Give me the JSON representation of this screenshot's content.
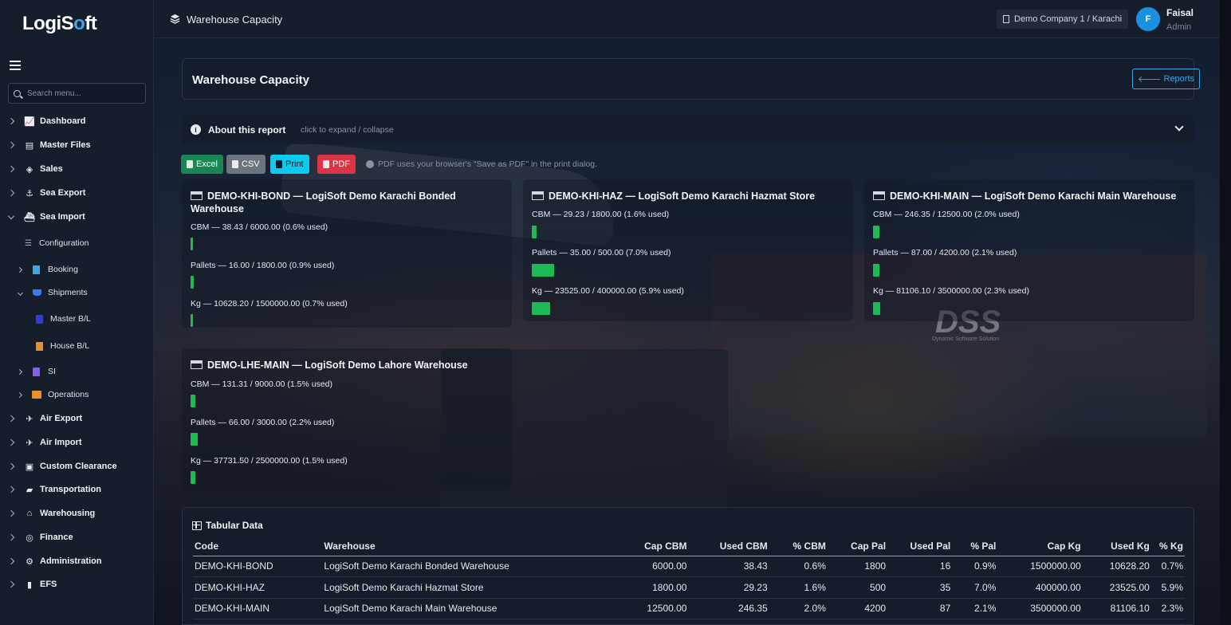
{
  "app": {
    "logo_prefix": "LogiS",
    "logo_o": "o",
    "logo_suffix": "ft",
    "accent": "#3aa8e8",
    "bar_color": "#1db954"
  },
  "sidebar": {
    "search_placeholder": "Search menu...",
    "items": [
      {
        "label": "Dashboard",
        "icon": "chart-line-icon"
      },
      {
        "label": "Master Files",
        "icon": "database-icon"
      },
      {
        "label": "Sales",
        "icon": "handshake-icon"
      },
      {
        "label": "Sea Export",
        "icon": "anchor-icon"
      },
      {
        "label": "Sea Import",
        "icon": "ship-icon"
      },
      {
        "label": "Air Export",
        "icon": "plane-departure-icon"
      },
      {
        "label": "Air Import",
        "icon": "plane-arrival-icon"
      },
      {
        "label": "Custom Clearance",
        "icon": "file-clearance-icon"
      },
      {
        "label": "Transportation",
        "icon": "truck-icon"
      },
      {
        "label": "Warehousing",
        "icon": "warehouse-icon"
      },
      {
        "label": "Finance",
        "icon": "coins-icon"
      },
      {
        "label": "Administration",
        "icon": "gear-icon"
      },
      {
        "label": "EFS",
        "icon": "folder-icon"
      }
    ],
    "sea_import_children": {
      "configuration": "Configuration",
      "booking": "Booking",
      "shipments": "Shipments",
      "master_bl": "Master B/L",
      "house_bl": "House B/L",
      "si": "SI",
      "operations": "Operations"
    }
  },
  "topbar": {
    "title": "Warehouse Capacity",
    "company": "Demo Company 1 / Karachi",
    "avatar_letter": "F",
    "user_name": "Faisal",
    "user_role": "Admin"
  },
  "page": {
    "title": "Warehouse Capacity",
    "reports_button": "Reports",
    "about_title": "About this report",
    "about_hint": "click to expand / collapse",
    "buttons": {
      "excel": "Excel",
      "csv": "CSV",
      "print": "Print",
      "pdf": "PDF"
    },
    "pdf_note": "PDF uses your browser's \"Save as PDF\" in the print dialog."
  },
  "warehouses": [
    {
      "title": "DEMO-KHI-BOND — LogiSoft Demo Karachi Bonded Warehouse",
      "cbm": {
        "label": "CBM — 38.43 / 6000.00 (0.6% used)",
        "pct": 0.6
      },
      "pallets": {
        "label": "Pallets — 16.00 / 1800.00 (0.9% used)",
        "pct": 0.9
      },
      "kg": {
        "label": "Kg — 10628.20 / 1500000.00 (0.7% used)",
        "pct": 0.7
      }
    },
    {
      "title": "DEMO-KHI-HAZ — LogiSoft Demo Karachi Hazmat Store",
      "cbm": {
        "label": "CBM — 29.23 / 1800.00 (1.6% used)",
        "pct": 1.6
      },
      "pallets": {
        "label": "Pallets — 35.00 / 500.00 (7.0% used)",
        "pct": 7.0
      },
      "kg": {
        "label": "Kg — 23525.00 / 400000.00 (5.9% used)",
        "pct": 5.9
      }
    },
    {
      "title": "DEMO-KHI-MAIN — LogiSoft Demo Karachi Main Warehouse",
      "cbm": {
        "label": "CBM — 246.35 / 12500.00 (2.0% used)",
        "pct": 2.0
      },
      "pallets": {
        "label": "Pallets — 87.00 / 4200.00 (2.1% used)",
        "pct": 2.1
      },
      "kg": {
        "label": "Kg — 81106.10 / 3500000.00 (2.3% used)",
        "pct": 2.3
      }
    },
    {
      "title": "DEMO-LHE-MAIN — LogiSoft Demo Lahore Warehouse",
      "cbm": {
        "label": "CBM — 131.31 / 9000.00 (1.5% used)",
        "pct": 1.5
      },
      "pallets": {
        "label": "Pallets — 66.00 / 3000.00 (2.2% used)",
        "pct": 2.2
      },
      "kg": {
        "label": "Kg — 37731.50 / 2500000.00 (1.5% used)",
        "pct": 1.5
      }
    }
  ],
  "watermark": {
    "brand": "DSS",
    "tagline": "Dynamic Software Solution"
  },
  "table": {
    "title": "Tabular Data",
    "headers": [
      "Code",
      "Warehouse",
      "Cap CBM",
      "Used CBM",
      "% CBM",
      "Cap Pal",
      "Used Pal",
      "% Pal",
      "Cap Kg",
      "Used Kg",
      "% Kg"
    ],
    "rows": [
      [
        "DEMO-KHI-BOND",
        "LogiSoft Demo Karachi Bonded Warehouse",
        "6000.00",
        "38.43",
        "0.6%",
        "1800",
        "16",
        "0.9%",
        "1500000.00",
        "10628.20",
        "0.7%"
      ],
      [
        "DEMO-KHI-HAZ",
        "LogiSoft Demo Karachi Hazmat Store",
        "1800.00",
        "29.23",
        "1.6%",
        "500",
        "35",
        "7.0%",
        "400000.00",
        "23525.00",
        "5.9%"
      ],
      [
        "DEMO-KHI-MAIN",
        "LogiSoft Demo Karachi Main Warehouse",
        "12500.00",
        "246.35",
        "2.0%",
        "4200",
        "87",
        "2.1%",
        "3500000.00",
        "81106.10",
        "2.3%"
      ]
    ]
  }
}
